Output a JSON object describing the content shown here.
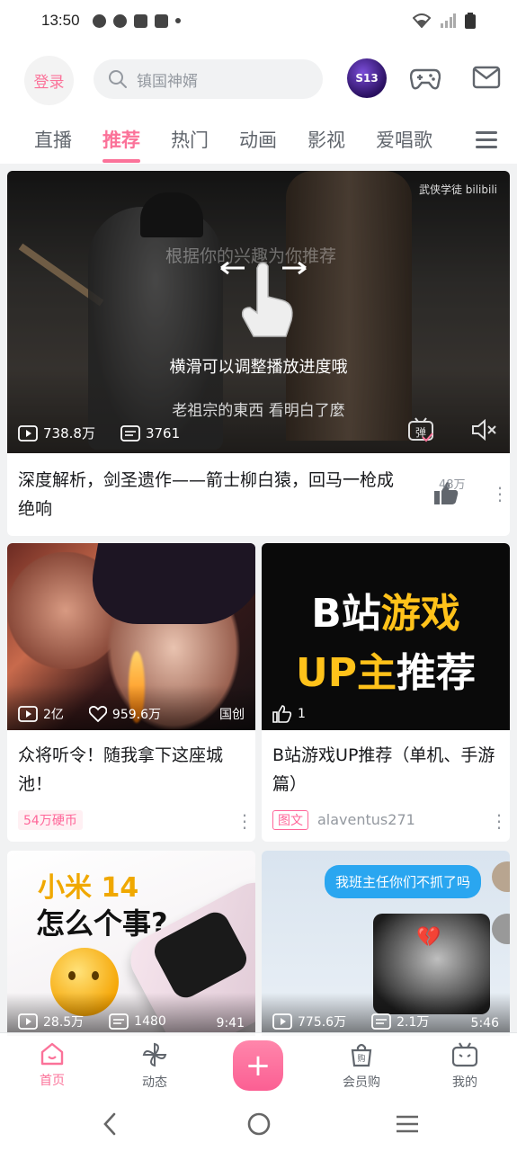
{
  "status": {
    "time": "13:50"
  },
  "header": {
    "login_label": "登录",
    "search_placeholder": "镇国神婿",
    "avatar_text": "S13"
  },
  "tabs": [
    {
      "label": "直播"
    },
    {
      "label": "推荐"
    },
    {
      "label": "热门"
    },
    {
      "label": "动画"
    },
    {
      "label": "影视"
    },
    {
      "label": "爱唱歌"
    }
  ],
  "active_tab": "推荐",
  "featured": {
    "watermark": "武侠学徒 bilibili",
    "overlay_hint_faint": "根据你的兴趣为你推荐",
    "gesture_hint": "横滑可以调整播放进度哦",
    "subtitle": "老祖宗的東西 看明白了麼",
    "views": "738.8万",
    "danmaku": "3761",
    "danmaku_toggle": "弹",
    "title": "深度解析，剑圣遗作——箭士柳白猿，回马一枪成绝响",
    "likes": "48万"
  },
  "cards": [
    {
      "views": "2亿",
      "likes": "959.6万",
      "badge": "国创",
      "title": "众将听令！随我拿下这座城池！",
      "tag": "54万硬币"
    },
    {
      "thumb_line1_white": "B站",
      "thumb_line1_yellow": "游戏",
      "thumb_line2_yellow": "UP主",
      "thumb_line2_white": "推荐",
      "likes": "1",
      "title": "B站游戏UP推荐（单机、手游篇）",
      "tag": "图文",
      "author": "alaventus271"
    },
    {
      "thumb_title1": "小米 14",
      "thumb_title2": "怎么个事?",
      "views": "28.5万",
      "danmaku": "1480",
      "duration": "9:41"
    },
    {
      "bubble": "我班主任你们不抓了吗",
      "views": "775.6万",
      "danmaku": "2.1万",
      "duration": "5:46"
    }
  ],
  "bottom_nav": [
    {
      "label": "首页"
    },
    {
      "label": "动态"
    },
    {
      "label": "+"
    },
    {
      "label": "会员购"
    },
    {
      "label": "我的"
    }
  ],
  "colors": {
    "accent": "#fb7299",
    "background": "#f1f2f3",
    "gray_text": "#9499a0"
  }
}
